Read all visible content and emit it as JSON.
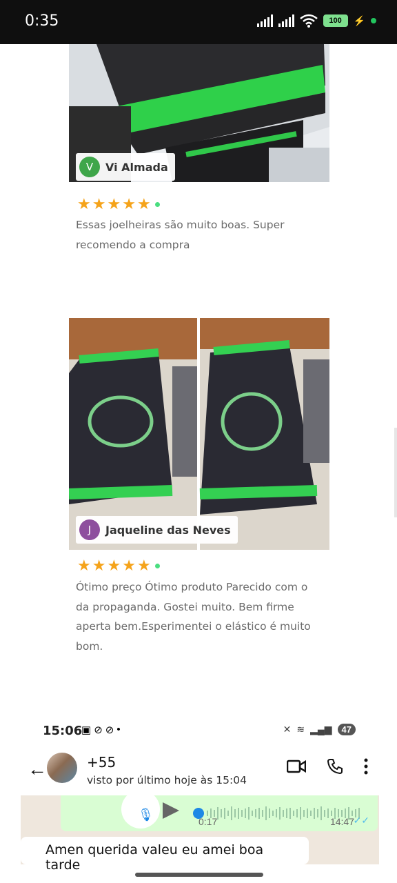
{
  "status_bar": {
    "time": "0:35",
    "battery": "100"
  },
  "reviews": [
    {
      "initial": "V",
      "avatar_color": "#3fa64a",
      "name": "Vi Almada",
      "rating": 5,
      "text": "Essas joelheiras são muito boas. Super recomendo a compra"
    },
    {
      "initial": "J",
      "avatar_color": "#8e4f9e",
      "name": "Jaqueline das Neves",
      "rating": 5,
      "text": "Ótimo preço Ótimo produto Parecido com o da propaganda. Gostei muito. Bem firme aperta bem.Esperimentei o elástico é muito bom."
    }
  ],
  "whatsapp": {
    "time": "15:06",
    "notification_count": "47",
    "contact": "+55",
    "last_seen": "visto por último hoje às 15:04",
    "voice_duration": "0:17",
    "voice_time": "14:47",
    "message": "Amen querida valeu eu amei boa tarde"
  }
}
